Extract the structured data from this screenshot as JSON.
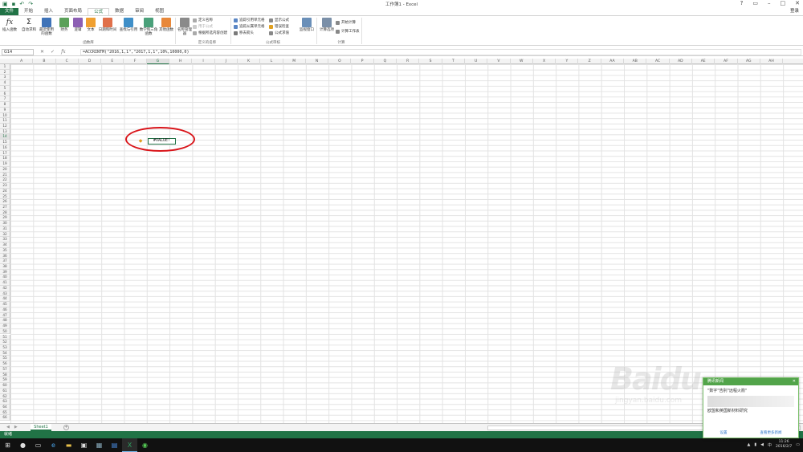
{
  "window": {
    "title": "工作簿1 - Excel",
    "login": "登录"
  },
  "tabs": [
    {
      "label": "文件",
      "kind": "file"
    },
    {
      "label": "开始"
    },
    {
      "label": "插入"
    },
    {
      "label": "页面布局"
    },
    {
      "label": "公式",
      "active": true
    },
    {
      "label": "数据"
    },
    {
      "label": "审阅"
    },
    {
      "label": "视图"
    }
  ],
  "ribbon": {
    "insert_function": "插入函数",
    "autosum": "自动求和",
    "recent": "最近使用的函数",
    "financial": "财务",
    "logical": "逻辑",
    "text": "文本",
    "datetime": "日期和时间",
    "lookup": "查找与引用",
    "math": "数学和三角函数",
    "other": "其他函数",
    "group_library": "函数库",
    "name_manager": "名称管理器",
    "define_name": "定义名称",
    "use_in_formula": "用于公式",
    "create_from_selection": "根据所选内容创建",
    "group_names": "定义的名称",
    "trace_precedents": "追踪引用单元格",
    "trace_dependents": "追踪从属单元格",
    "remove_arrows": "移去箭头",
    "show_formulas": "显示公式",
    "error_checking": "错误检查",
    "evaluate_formula": "公式求值",
    "group_auditing": "公式审核",
    "watch_window": "监视窗口",
    "calc_options": "计算选项",
    "calc_now": "开始计算",
    "calc_sheet": "计算工作表",
    "group_calc": "计算"
  },
  "formula_bar": {
    "name_box": "G14",
    "formula": "=ACCRINTM(\"2016,1,1\",\"2017,1,1\",10%,10000,0)"
  },
  "sheet": {
    "columns": [
      "A",
      "B",
      "C",
      "D",
      "E",
      "F",
      "G",
      "H",
      "I",
      "J",
      "K",
      "L",
      "M",
      "N",
      "O",
      "P",
      "Q",
      "R",
      "S",
      "T",
      "U",
      "V",
      "W",
      "X",
      "Y",
      "Z",
      "AA",
      "AB",
      "AC",
      "AD",
      "AE",
      "AF",
      "AG",
      "AH"
    ],
    "selected_column": "G",
    "selected_row": "14",
    "rows": [
      "1",
      "2",
      "3",
      "4",
      "5",
      "6",
      "7",
      "8",
      "9",
      "10",
      "11",
      "12",
      "13",
      "14",
      "15",
      "16",
      "17",
      "18",
      "19",
      "20",
      "21",
      "22",
      "23",
      "24",
      "25",
      "26",
      "27",
      "28",
      "29",
      "30",
      "31",
      "32",
      "33",
      "34",
      "35",
      "36",
      "37",
      "38",
      "39",
      "40",
      "41",
      "42",
      "43",
      "44",
      "45",
      "46",
      "47",
      "48",
      "49",
      "50",
      "51",
      "52",
      "53",
      "54",
      "55",
      "56",
      "57",
      "58",
      "59",
      "60",
      "61",
      "62",
      "63",
      "64",
      "65",
      "66"
    ],
    "active_cell_value": "#VALUE!"
  },
  "sheet_tabs": {
    "active": "Sheet1",
    "add": "+"
  },
  "status": {
    "text": "就绪"
  },
  "taskbar": {
    "time": "11:26",
    "date": "2016/2/7"
  },
  "popup": {
    "header": "腾讯新闻",
    "headline": "\"数字\"告别\"远程火箭\"",
    "line2": "欧盟和英国新材料研究",
    "footer_left": "设置",
    "footer_right": "查看更多新闻"
  },
  "watermark": {
    "brand": "Baidu",
    "url": "jingyan.baidu.com"
  },
  "colors": {
    "excel_green": "#217346",
    "annotation_red": "#d9151a"
  }
}
